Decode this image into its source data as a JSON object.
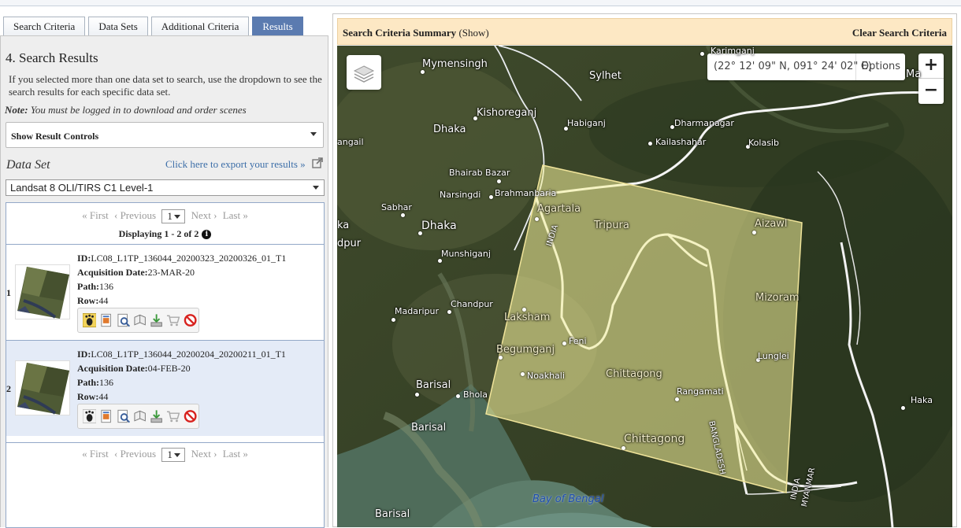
{
  "tabs": [
    "Search Criteria",
    "Data Sets",
    "Additional Criteria",
    "Results"
  ],
  "left": {
    "title": "4. Search Results",
    "intro": "If you selected more than one data set to search, use the dropdown to see the search results for each specific data set.",
    "note_label": "Note:",
    "note_text": " You must be logged in to download and order scenes",
    "controls_label": "Show Result Controls",
    "dataset_label": "Data Set",
    "export_link": "Click here to export your results »",
    "dataset_value": "Landsat 8 OLI/TIRS C1 Level-1"
  },
  "pager": {
    "first": "« First",
    "previous": "‹ Previous",
    "page": "1",
    "next": "Next ›",
    "last": "Last »",
    "displaying": "Displaying 1 - 2 of 2"
  },
  "results": [
    {
      "num": "1",
      "id_label": "ID:",
      "id": "LC08_L1TP_136044_20200323_20200326_01_T1",
      "date_label": "Acquisition Date:",
      "date": "23-MAR-20",
      "path_label": "Path:",
      "path": "136",
      "row_label": "Row:",
      "row": "44"
    },
    {
      "num": "2",
      "id_label": "ID:",
      "id": "LC08_L1TP_136044_20200204_20200211_01_T1",
      "date_label": "Acquisition Date:",
      "date": "04-FEB-20",
      "path_label": "Path:",
      "path": "136",
      "row_label": "Row:",
      "row": "44"
    }
  ],
  "result_icons": [
    "footprint-icon",
    "browse-overlay-icon",
    "show-metadata-icon",
    "compare-icon",
    "download-icon",
    "add-to-cart-icon",
    "exclude-icon"
  ],
  "summary": {
    "title": "Search Criteria Summary",
    "show": "(Show)",
    "clear": "Clear Search Criteria"
  },
  "map": {
    "coords": "(22° 12' 09\" N, 091° 24' 02\" E)",
    "options": "Options",
    "zoom_in": "+",
    "zoom_out": "−",
    "places": {
      "karimganj": "Karimganj",
      "mymensingh": "Mymensingh",
      "sylhet": "Sylhet",
      "ma": "Ma",
      "kishoreganj": "Kishoreganj",
      "habiganj": "Habiganj",
      "dharmanagar": "Dharmanagar",
      "dhaka_small": "Dhaka",
      "kailashahar": "Kailashahar",
      "kolasib": "Kolasib",
      "gangail": "angail",
      "bhairab": "Bhairab Bazar",
      "narsingdi": "Narsingdi",
      "brahmanbaria": "Brahmanbaria",
      "agartala": "Agartala",
      "sabhar": "Sabhar",
      "tripura": "Tripura",
      "aizawl": "Aizawl",
      "ka": "ka",
      "dhaka": "Dhaka",
      "dpur": "dpur",
      "india": "INDIA",
      "munshiganj": "Munshiganj",
      "chandpur": "Chandpur",
      "mizoram": "Mizoram",
      "madaripur": "Madaripur",
      "laksham": "Laksham",
      "feni": "Feni",
      "begumganj": "Begumganj",
      "lunglei": "Lunglei",
      "noakhali": "Noakhali",
      "chittagong_region": "Chittagong",
      "barisal_town": "Barisal",
      "bhola": "Bhola",
      "rangamati": "Rangamati",
      "haka": "Haka",
      "barisal_region": "Barisal",
      "chittagong": "Chittagong",
      "bangladesh": "BANGLADESH",
      "india_myanmar": "INDIA",
      "myanmar": "MYANMAR",
      "bay_of_bengal": "Bay of Bengal",
      "barisal_bottom": "Barisal"
    }
  }
}
